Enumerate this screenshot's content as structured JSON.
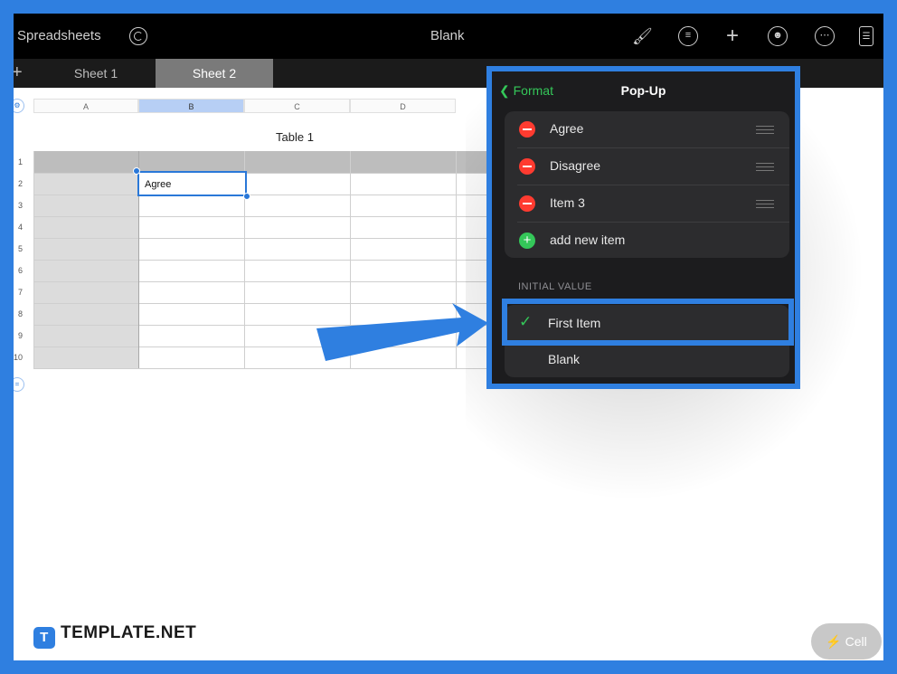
{
  "toolbar": {
    "back_label": "Spreadsheets",
    "title": "Blank",
    "icons": [
      "undo-icon",
      "brush-icon",
      "filter-icon",
      "plus-icon",
      "collaborate-icon",
      "more-icon",
      "document-view-icon"
    ]
  },
  "tabs": [
    {
      "label": "Sheet 1",
      "active": false
    },
    {
      "label": "Sheet 2",
      "active": true
    }
  ],
  "sheet": {
    "columns": [
      "A",
      "B",
      "C",
      "D"
    ],
    "rows": [
      "1",
      "2",
      "3",
      "4",
      "5",
      "6",
      "7",
      "8",
      "9",
      "10"
    ],
    "table_title": "Table 1",
    "selected_cell_value": "Agree"
  },
  "popover": {
    "back_label": "Format",
    "title": "Pop-Up",
    "items": [
      "Agree",
      "Disagree",
      "Item 3"
    ],
    "add_label": "add new item",
    "section_header": "INITIAL VALUE",
    "options": [
      {
        "label": "First Item",
        "selected": true
      },
      {
        "label": "Blank",
        "selected": false
      }
    ]
  },
  "branding": "TEMPLATE.NET",
  "cell_button": "Cell",
  "colors": {
    "accent": "#2f7fe0",
    "green": "#34c759",
    "red": "#ff3b30"
  }
}
